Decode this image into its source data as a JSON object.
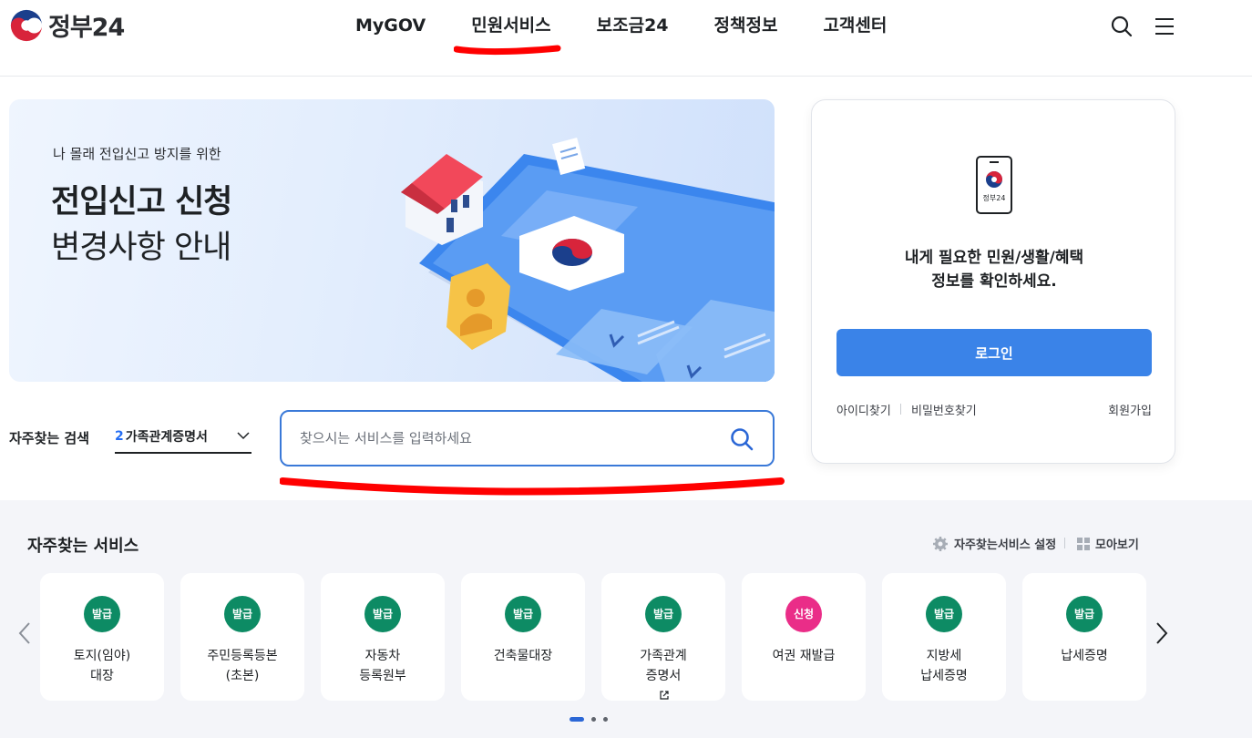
{
  "header": {
    "logo_text": "정부24",
    "nav": [
      "MyGOV",
      "민원서비스",
      "보조금24",
      "정책정보",
      "고객센터"
    ],
    "search_icon": "search-icon",
    "menu_icon": "hamburger-menu-icon"
  },
  "banner": {
    "subtitle": "나 몰래 전입신고 방지를 위한",
    "title_line1": "전입신고 신청",
    "title_line2": "변경사항 안내"
  },
  "search": {
    "fav_label": "자주찾는 검색",
    "fav_num": "2",
    "fav_text": "가족관계증명서",
    "placeholder": "찾으시는 서비스를 입력하세요"
  },
  "login": {
    "phone_label": "정부24",
    "message_line1": "내게 필요한 민원/생활/혜택",
    "message_line2": "정보를 확인하세요.",
    "button": "로그인",
    "find_id": "아이디찾기",
    "find_pw": "비밀번호찾기",
    "signup": "회원가입"
  },
  "services": {
    "title": "자주찾는 서비스",
    "settings": "자주찾는서비스 설정",
    "view_all": "모아보기",
    "items": [
      {
        "badge": "발급",
        "line1": "토지(임야)",
        "line2": "대장"
      },
      {
        "badge": "발급",
        "line1": "주민등록등본",
        "line2": "(초본)"
      },
      {
        "badge": "발급",
        "line1": "자동차",
        "line2": "등록원부"
      },
      {
        "badge": "발급",
        "line1": "건축물대장",
        "line2": ""
      },
      {
        "badge": "발급",
        "line1": "가족관계",
        "line2": "증명서"
      },
      {
        "badge": "신청",
        "line1": "여권 재발급",
        "line2": ""
      },
      {
        "badge": "발급",
        "line1": "지방세",
        "line2": "납세증명"
      },
      {
        "badge": "발급",
        "line1": "납세증명",
        "line2": ""
      }
    ]
  },
  "colors": {
    "primary": "#3a83e8",
    "issue_badge": "#0d8b64",
    "apply_badge": "#ea2d88",
    "annotation": "#ff0000"
  }
}
